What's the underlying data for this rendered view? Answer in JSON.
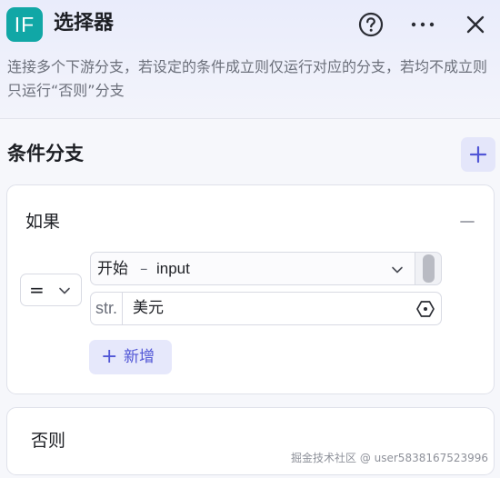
{
  "header": {
    "badge": "IF",
    "title": "选择器",
    "description": "连接多个下游分支，若设定的条件成立则仅运行对应的分支，若均不成立则只运行“否则”分支",
    "icons": [
      "help-circle-icon",
      "more-horizontal-icon",
      "close-icon"
    ]
  },
  "section": {
    "title": "条件分支",
    "add_icon": "plus-icon"
  },
  "if_branch": {
    "label": "如果",
    "collapse_icon": "minus-icon",
    "condition": {
      "operator": "=",
      "variable": {
        "source": "开始",
        "separator": "–",
        "name": "input"
      },
      "value": {
        "type": "str.",
        "text": "美元",
        "icon": "variable-hex-icon"
      }
    },
    "add_condition": {
      "plus": "+",
      "label": "新增"
    }
  },
  "else_branch": {
    "label": "否则"
  },
  "watermark": "掘金技术社区 @ user5838167523996",
  "colors": {
    "badge": "#11a7a6",
    "accent": "#5156d6",
    "accent_bg": "#e6e8fb",
    "header_bg": "#e9ecfb",
    "border": "#d8dae3"
  }
}
